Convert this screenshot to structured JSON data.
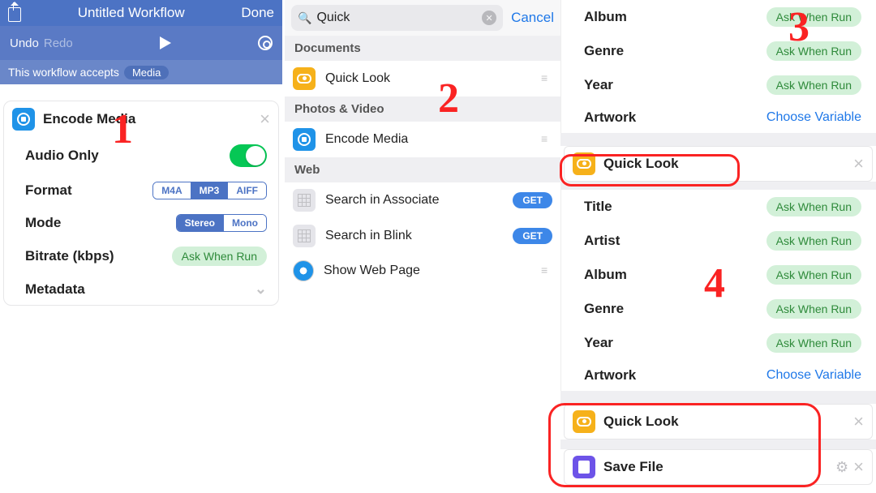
{
  "panel1": {
    "header_title": "Untitled Workflow",
    "done": "Done",
    "undo": "Undo",
    "redo": "Redo",
    "accepts_label": "This workflow accepts",
    "accepts_badge": "Media",
    "card_title": "Encode Media",
    "opts": {
      "audio_only": "Audio Only",
      "format": "Format",
      "format_segs": [
        "M4A",
        "MP3",
        "AIFF"
      ],
      "mode": "Mode",
      "mode_segs": [
        "Stereo",
        "Mono"
      ],
      "bitrate": "Bitrate (kbps)",
      "bitrate_val": "Ask When Run",
      "metadata": "Metadata"
    }
  },
  "panel2": {
    "search_value": "Quick",
    "cancel": "Cancel",
    "sections": {
      "documents": "Documents",
      "photos": "Photos & Video",
      "web": "Web"
    },
    "rows": {
      "quick_look": "Quick Look",
      "encode_media": "Encode Media",
      "search_assoc": "Search in Associate",
      "search_blink": "Search in Blink",
      "show_web": "Show Web Page",
      "get": "GET"
    }
  },
  "meta_a": {
    "album": "Album",
    "genre": "Genre",
    "year": "Year",
    "artwork": "Artwork",
    "ask": "Ask When Run",
    "choose": "Choose Variable"
  },
  "meta_b": {
    "title": "Title",
    "artist": "Artist",
    "album": "Album",
    "genre": "Genre",
    "year": "Year",
    "artwork": "Artwork",
    "ask": "Ask When Run",
    "choose": "Choose Variable"
  },
  "quick_look_card": "Quick Look",
  "save_file_card": "Save File",
  "annotations": {
    "a1": "1",
    "a2": "2",
    "a3": "3",
    "a4": "4"
  }
}
